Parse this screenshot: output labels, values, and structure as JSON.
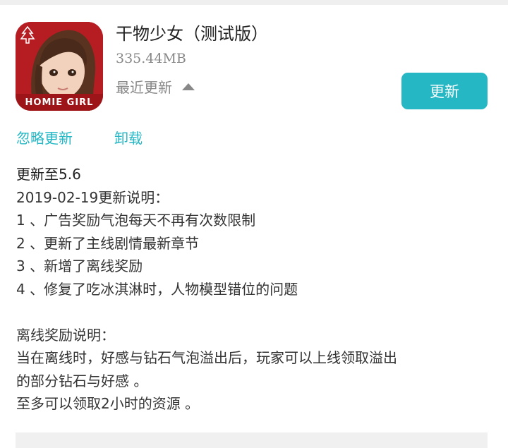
{
  "app": {
    "title": "干物少女（测试版）",
    "size": "335.44MB",
    "recent_update_label": "最近更新",
    "icon_label": "HOMIE GIRL",
    "update_button": "更新"
  },
  "actions": {
    "ignore_update": "忽略更新",
    "uninstall": "卸载"
  },
  "notes": {
    "version_line": "更新至5.6",
    "date_line": "2019-02-19更新说明：",
    "items": [
      "1 、广告奖励气泡每天不再有次数限制",
      "2 、更新了主线剧情最新章节",
      "3 、新增了离线奖励",
      "4 、修复了吃冰淇淋时，人物模型错位的问题"
    ],
    "offline_title": "离线奖励说明：",
    "offline_lines": [
      "当在离线时，好感与钻石气泡溢出后，玩家可以上线领取溢出",
      "的部分钻石与好感 。",
      "至多可以领取2小时的资源 。"
    ]
  },
  "colors": {
    "accent": "#26b7c4",
    "icon_bg": "#b51d22",
    "muted_text": "#888888"
  },
  "icons": [
    "caret-up-icon",
    "christmas-tree-icon"
  ]
}
